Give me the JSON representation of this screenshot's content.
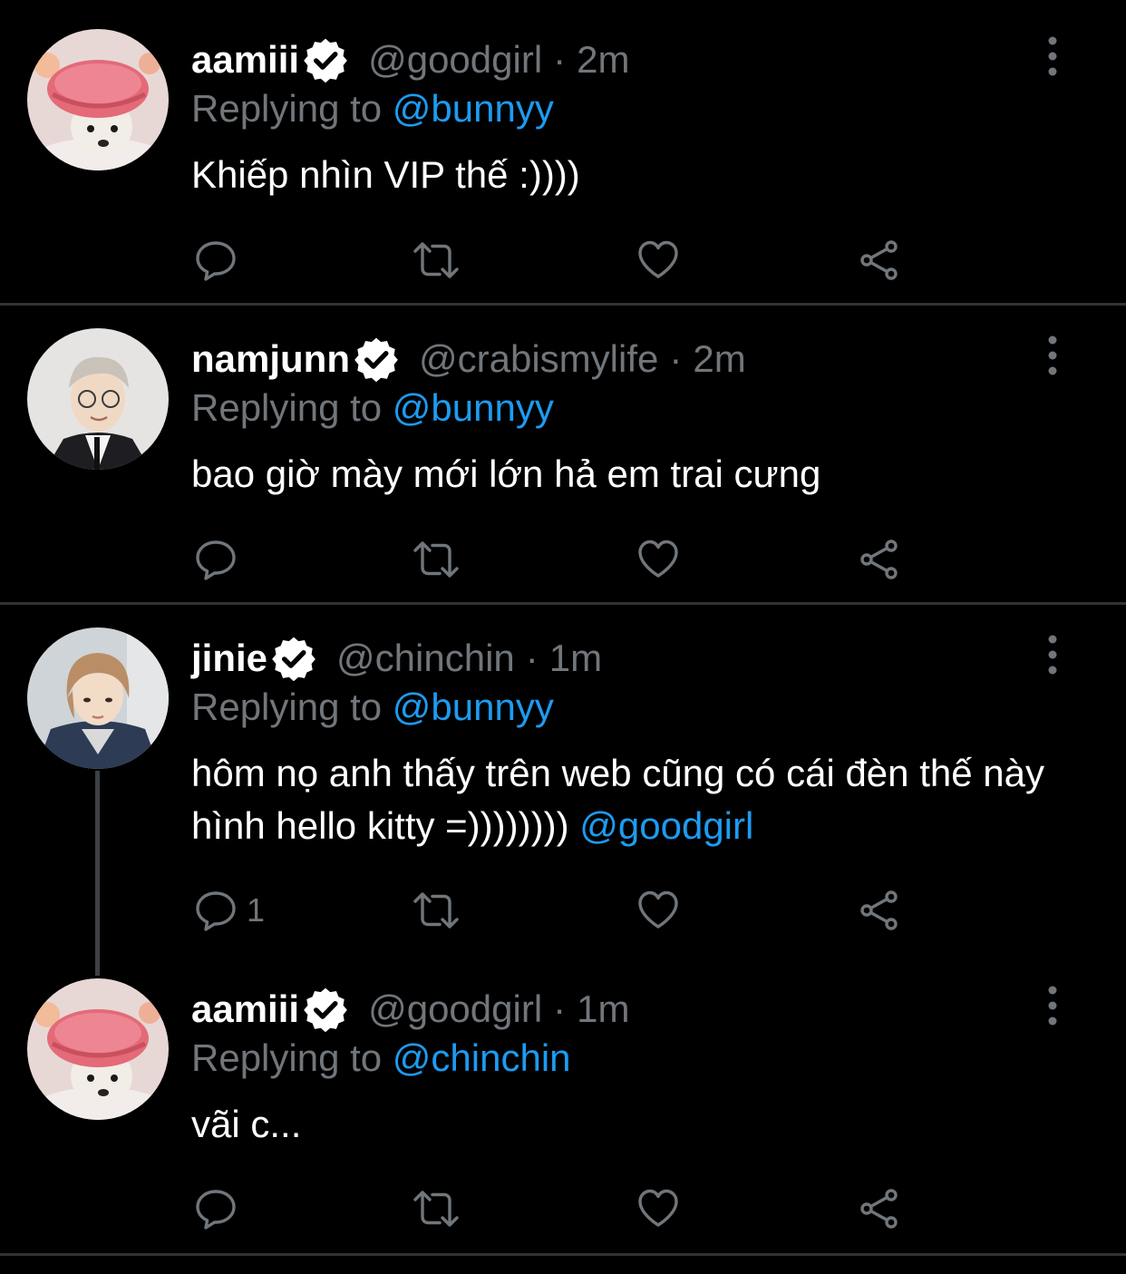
{
  "colors": {
    "background": "#000000",
    "text": "#ffffff",
    "muted": "#71767b",
    "mention": "#1d9bf0",
    "divider": "#2f3336"
  },
  "icons": {
    "reply": "reply-icon",
    "retweet": "retweet-icon",
    "like": "heart-icon",
    "share": "share-icon",
    "more": "more-vertical-icon",
    "verified": "verified-badge-icon"
  },
  "tweets": [
    {
      "display_name": "aamiii",
      "handle": "@goodgirl",
      "separator": "·",
      "time": "2m",
      "replying_prefix": "Replying to",
      "replying_to": "@bunnyy",
      "text": "Khiếp nhìn VIP thế :))))",
      "text_mention": "",
      "reply_count": ""
    },
    {
      "display_name": "namjunn",
      "handle": "@crabismylife",
      "separator": "·",
      "time": "2m",
      "replying_prefix": "Replying to",
      "replying_to": "@bunnyy",
      "text": "bao giờ mày mới lớn hả em trai cưng",
      "text_mention": "",
      "reply_count": ""
    },
    {
      "display_name": "jinie",
      "handle": "@chinchin",
      "separator": "·",
      "time": "1m",
      "replying_prefix": "Replying to",
      "replying_to": "@bunnyy",
      "text": "hôm nọ anh thấy trên web cũng có cái đèn thế này hình hello kitty =)))))))) ",
      "text_mention": "@goodgirl",
      "reply_count": "1"
    },
    {
      "display_name": "aamiii",
      "handle": "@goodgirl",
      "separator": "·",
      "time": "1m",
      "replying_prefix": "Replying to",
      "replying_to": "@chinchin",
      "text": "vãi c...",
      "text_mention": "",
      "reply_count": ""
    }
  ]
}
